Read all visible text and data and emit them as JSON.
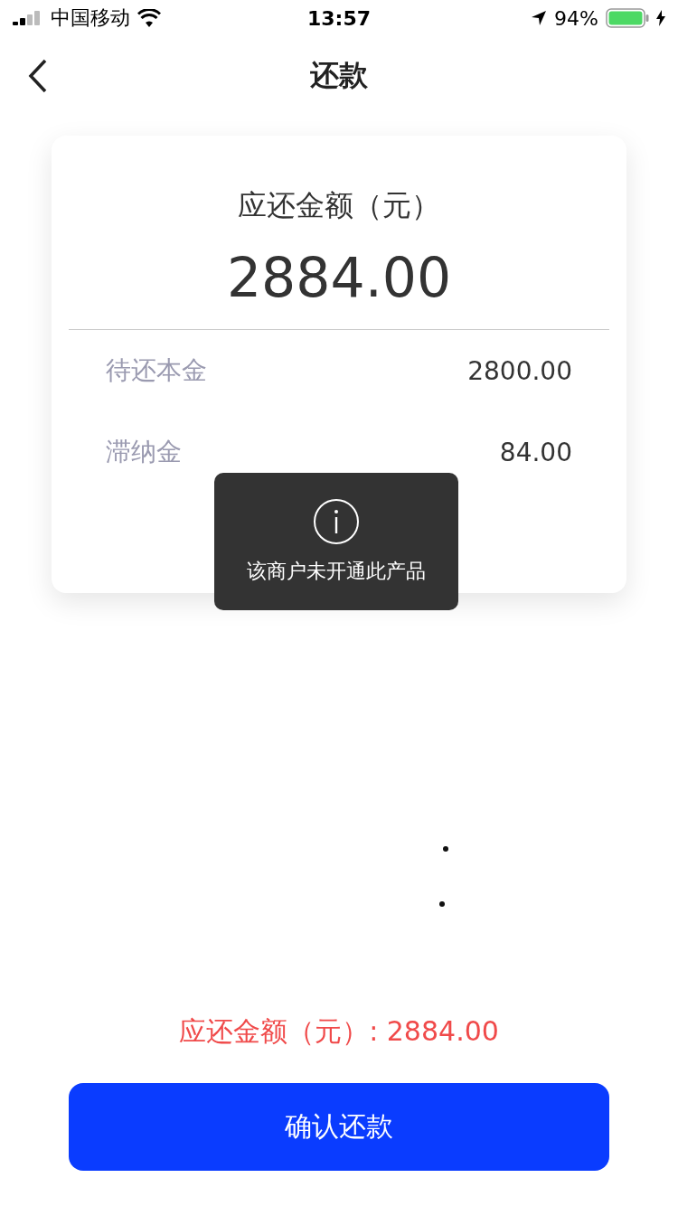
{
  "status_bar": {
    "carrier": "中国移动",
    "time": "13:57",
    "battery": "94%"
  },
  "nav": {
    "title": "还款"
  },
  "card": {
    "label": "应还金额（元）",
    "amount": "2884.00",
    "rows": [
      {
        "label": "待还本金",
        "value": "2800.00"
      },
      {
        "label": "滞纳金",
        "value": "84.00"
      }
    ]
  },
  "toast": {
    "message": "该商户未开通此产品"
  },
  "summary": "应还金额（元）: 2884.00",
  "confirm_button": "确认还款"
}
